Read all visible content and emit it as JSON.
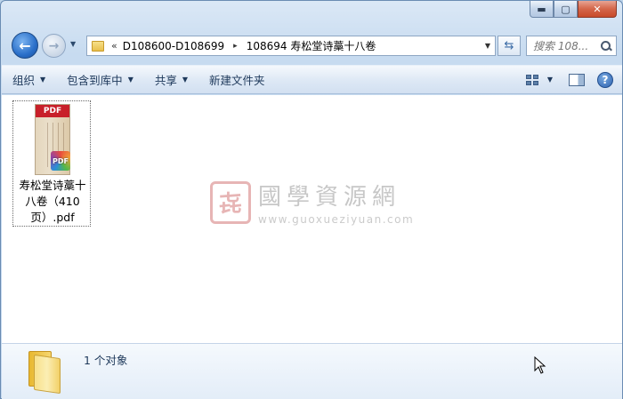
{
  "window": {
    "controls": {
      "minimize": "▬",
      "maximize": "▢",
      "close": "✕"
    }
  },
  "nav": {
    "back_icon": "back-arrow-icon",
    "forward_icon": "forward-arrow-icon",
    "address": {
      "overflow": "«",
      "crumbs": [
        "D108600-D108699",
        "108694 寿松堂诗藁十八卷"
      ],
      "separator": "▸"
    },
    "search": {
      "placeholder": "搜索 108..."
    }
  },
  "toolbar": {
    "organize": "组织",
    "include_in_library": "包含到库中",
    "share": "共享",
    "new_folder": "新建文件夹",
    "help": "?"
  },
  "files": [
    {
      "name": "寿松堂诗藁十八卷（410页）.pdf",
      "thumb_label": "PDF",
      "badge_label": "PDF"
    }
  ],
  "watermark": {
    "seal_char": "㐂",
    "name": "國學資源網",
    "url": "www.guoxueziyuan.com"
  },
  "status": {
    "count_text": "1 个对象"
  },
  "colors": {
    "accent": "#1e395b",
    "pdf_red": "#c8202a"
  }
}
